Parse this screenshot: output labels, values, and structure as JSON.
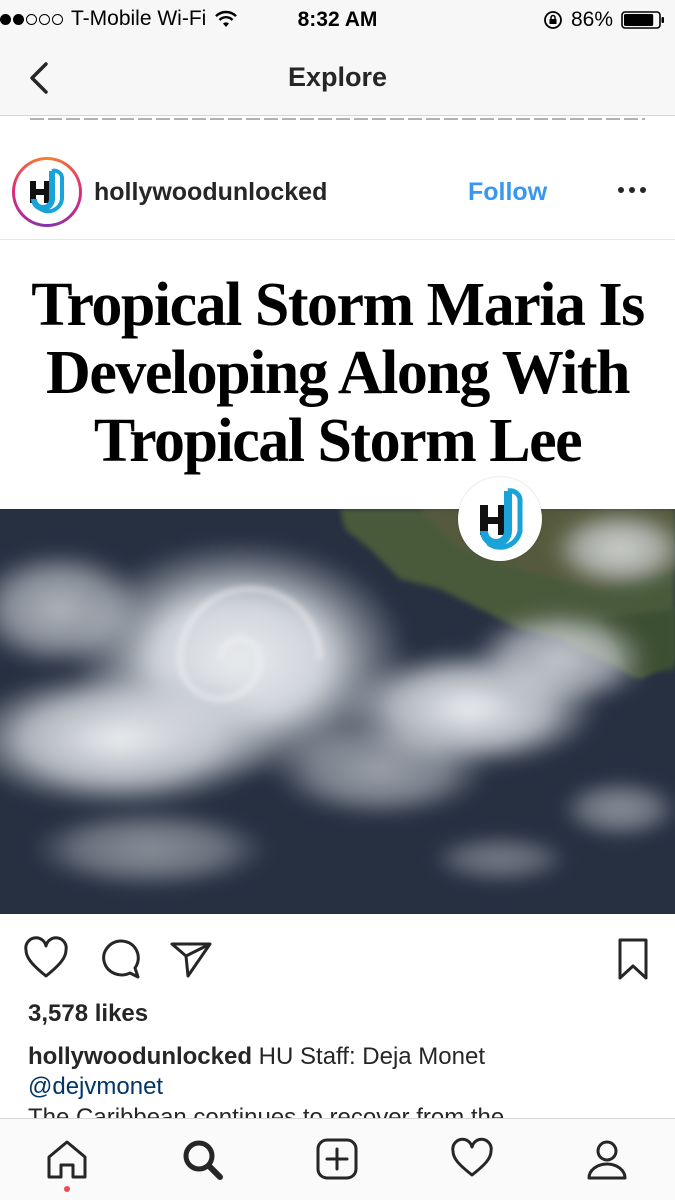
{
  "status_bar": {
    "carrier": "T-Mobile Wi-Fi",
    "time": "8:32 AM",
    "battery": "86%",
    "battery_level": 0.86
  },
  "nav": {
    "title": "Explore"
  },
  "post": {
    "username": "hollywoodunlocked",
    "follow_label": "Follow",
    "headline_lines": [
      "Tropical Storm Maria Is",
      "Developing Along With",
      "Tropical Storm Lee"
    ],
    "likes": "3,578 likes",
    "caption_user": "hollywoodunlocked",
    "caption_text": " HU Staff: Deja Monet",
    "caption_mention": "@dejvmonet",
    "caption_more": "The Caribbean continues to recover from the"
  },
  "icons": {
    "back": "chevron-left-icon",
    "more": "more-dots-icon",
    "like": "heart-icon",
    "comment": "comment-icon",
    "share": "send-icon",
    "save": "bookmark-icon",
    "tabs": [
      "home-icon",
      "search-icon",
      "add-icon",
      "activity-icon",
      "profile-icon"
    ]
  },
  "colors": {
    "follow": "#3897f0",
    "mention": "#003569",
    "notification_dot": "#ed4956",
    "brand_blue": "#1aa3d9"
  }
}
